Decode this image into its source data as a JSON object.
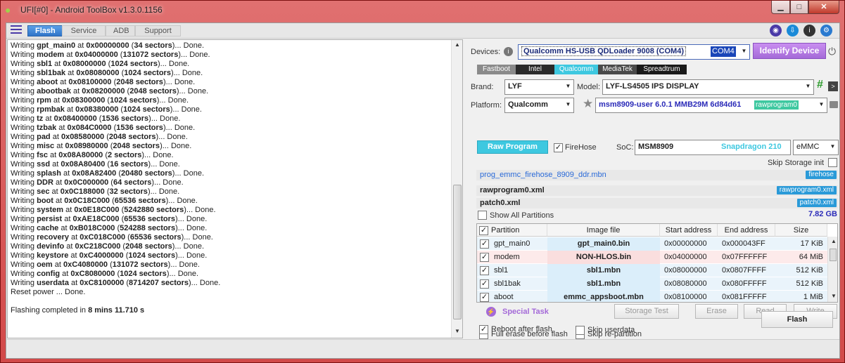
{
  "window": {
    "title": "UFI[#0] - Android ToolBox v1.3.0.1156",
    "min": "▁",
    "max": "□",
    "close": "✕"
  },
  "tabs": [
    "Flash",
    "Service",
    "ADB",
    "Support"
  ],
  "log": {
    "lines": [
      [
        "Writing ",
        "gpt_main0",
        " at ",
        "0x00000000",
        " (",
        "34 sectors",
        ")... Done."
      ],
      [
        "Writing ",
        "modem",
        " at ",
        "0x04000000",
        " (",
        "131072 sectors",
        ")... Done."
      ],
      [
        "Writing ",
        "sbl1",
        " at ",
        "0x08000000",
        " (",
        "1024 sectors",
        ")... Done."
      ],
      [
        "Writing ",
        "sbl1bak",
        " at ",
        "0x08080000",
        " (",
        "1024 sectors",
        ")... Done."
      ],
      [
        "Writing ",
        "aboot",
        " at ",
        "0x08100000",
        " (",
        "2048 sectors",
        ")... Done."
      ],
      [
        "Writing ",
        "abootbak",
        " at ",
        "0x08200000",
        " (",
        "2048 sectors",
        ")... Done."
      ],
      [
        "Writing ",
        "rpm",
        " at ",
        "0x08300000",
        " (",
        "1024 sectors",
        ")... Done."
      ],
      [
        "Writing ",
        "rpmbak",
        " at ",
        "0x08380000",
        " (",
        "1024 sectors",
        ")... Done."
      ],
      [
        "Writing ",
        "tz",
        " at ",
        "0x08400000",
        " (",
        "1536 sectors",
        ")... Done."
      ],
      [
        "Writing ",
        "tzbak",
        " at ",
        "0x084C0000",
        " (",
        "1536 sectors",
        ")... Done."
      ],
      [
        "Writing ",
        "pad",
        " at ",
        "0x08580000",
        " (",
        "2048 sectors",
        ")... Done."
      ],
      [
        "Writing ",
        "misc",
        " at ",
        "0x08980000",
        " (",
        "2048 sectors",
        ")... Done."
      ],
      [
        "Writing ",
        "fsc",
        " at ",
        "0x08A80000",
        " (",
        "2 sectors",
        ")... Done."
      ],
      [
        "Writing ",
        "ssd",
        " at ",
        "0x08A80400",
        " (",
        "16 sectors",
        ")... Done."
      ],
      [
        "Writing ",
        "splash",
        " at ",
        "0x08A82400",
        " (",
        "20480 sectors",
        ")... Done."
      ],
      [
        "Writing ",
        "DDR",
        " at ",
        "0x0C000000",
        " (",
        "64 sectors",
        ")... Done."
      ],
      [
        "Writing ",
        "sec",
        " at ",
        "0x0C188000",
        " (",
        "32 sectors",
        ")... Done."
      ],
      [
        "Writing ",
        "boot",
        " at ",
        "0x0C18C000",
        " (",
        "65536 sectors",
        ")... Done."
      ],
      [
        "Writing ",
        "system",
        " at ",
        "0x0E18C000",
        " (",
        "5242880 sectors",
        ")... Done."
      ],
      [
        "Writing ",
        "persist",
        " at ",
        "0xAE18C000",
        " (",
        "65536 sectors",
        ")... Done."
      ],
      [
        "Writing ",
        "cache",
        " at ",
        "0xB018C000",
        " (",
        "524288 sectors",
        ")... Done."
      ],
      [
        "Writing ",
        "recovery",
        " at ",
        "0xC018C000",
        " (",
        "65536 sectors",
        ")... Done."
      ],
      [
        "Writing ",
        "devinfo",
        " at ",
        "0xC218C000",
        " (",
        "2048 sectors",
        ")... Done."
      ],
      [
        "Writing ",
        "keystore",
        " at ",
        "0xC4000000",
        " (",
        "1024 sectors",
        ")... Done."
      ],
      [
        "Writing ",
        "oem",
        " at ",
        "0xC4080000",
        " (",
        "131072 sectors",
        ")... Done."
      ],
      [
        "Writing ",
        "config",
        " at ",
        "0xC8080000",
        " (",
        "1024 sectors",
        ")... Done."
      ],
      [
        "Writing ",
        "userdata",
        " at ",
        "0xC8100000",
        " (",
        "8714207 sectors",
        ")... Done."
      ]
    ],
    "reset": "Reset power ... Done.",
    "completed_prefix": "Flashing completed in ",
    "completed_time": "8 mins 11.710 s"
  },
  "devices": {
    "label": "Devices:",
    "value": "Qualcomm HS-USB QDLoader 9008 (COM4)",
    "port": "COM4",
    "identify": "Identify Device"
  },
  "modes": [
    "Fastboot",
    "Intel",
    "Qualcomm",
    "MediaTek",
    "Spreadtrum"
  ],
  "brand": {
    "label": "Brand:",
    "value": "LYF"
  },
  "model": {
    "label": "Model:",
    "value": "LYF-LS4505 IPS DISPLAY"
  },
  "platform": {
    "label": "Platform:",
    "value": "Qualcomm"
  },
  "build": {
    "value": "msm8909-user 6.0.1 MMB29M 6d84d61",
    "tag": "rawprogram0"
  },
  "raw_program": "Raw Program",
  "firehose": {
    "label": "FireHose",
    "checked": true
  },
  "soc": {
    "label": "SoC:",
    "value": "MSM8909",
    "name": "Snapdragon 210",
    "storage": "eMMC"
  },
  "skip_storage": "Skip Storage init",
  "files": [
    {
      "name": "prog_emmc_firehose_8909_ddr.mbn",
      "tag": "firehose"
    },
    {
      "name": "rawprogram0.xml",
      "tag": "rawprogram0.xml"
    },
    {
      "name": "patch0.xml",
      "tag": "patch0.xml"
    }
  ],
  "show_all": "Show All Partitions",
  "size_total": "7.82 GB",
  "table": {
    "headers": [
      "Partition",
      "Image file",
      "Start address",
      "End address",
      "Size"
    ],
    "rows": [
      {
        "p": "gpt_main0",
        "img": "gpt_main0.bin",
        "start": "0x00000000",
        "end": "0x000043FF",
        "size": "17 KiB",
        "hl": "#dbeefa"
      },
      {
        "p": "modem",
        "img": "NON-HLOS.bin",
        "start": "0x04000000",
        "end": "0x07FFFFFF",
        "size": "64 MiB",
        "hl": "#fadede"
      },
      {
        "p": "sbl1",
        "img": "sbl1.mbn",
        "start": "0x08000000",
        "end": "0x0807FFFF",
        "size": "512 KiB",
        "hl": "#dbeefa"
      },
      {
        "p": "sbl1bak",
        "img": "sbl1.mbn",
        "start": "0x08080000",
        "end": "0x080FFFFF",
        "size": "512 KiB",
        "hl": "#dbeefa"
      },
      {
        "p": "aboot",
        "img": "emmc_appsboot.mbn",
        "start": "0x08100000",
        "end": "0x081FFFFF",
        "size": "1 MiB",
        "hl": "#dbeefa"
      }
    ]
  },
  "special_task": "Special Task",
  "actions": [
    "Storage Test",
    "Erase",
    "Read",
    "Write"
  ],
  "opts": {
    "full_erase": "Full erase before flash",
    "reboot": "Reboot after flash",
    "skip_repart": "Skip re-partition",
    "skip_userdata": "Skip userdata"
  },
  "flash": "Flash",
  "colors": {
    "accent": "#2f74c8",
    "cyan": "#3ec8e0",
    "purple": "#b36be0"
  }
}
